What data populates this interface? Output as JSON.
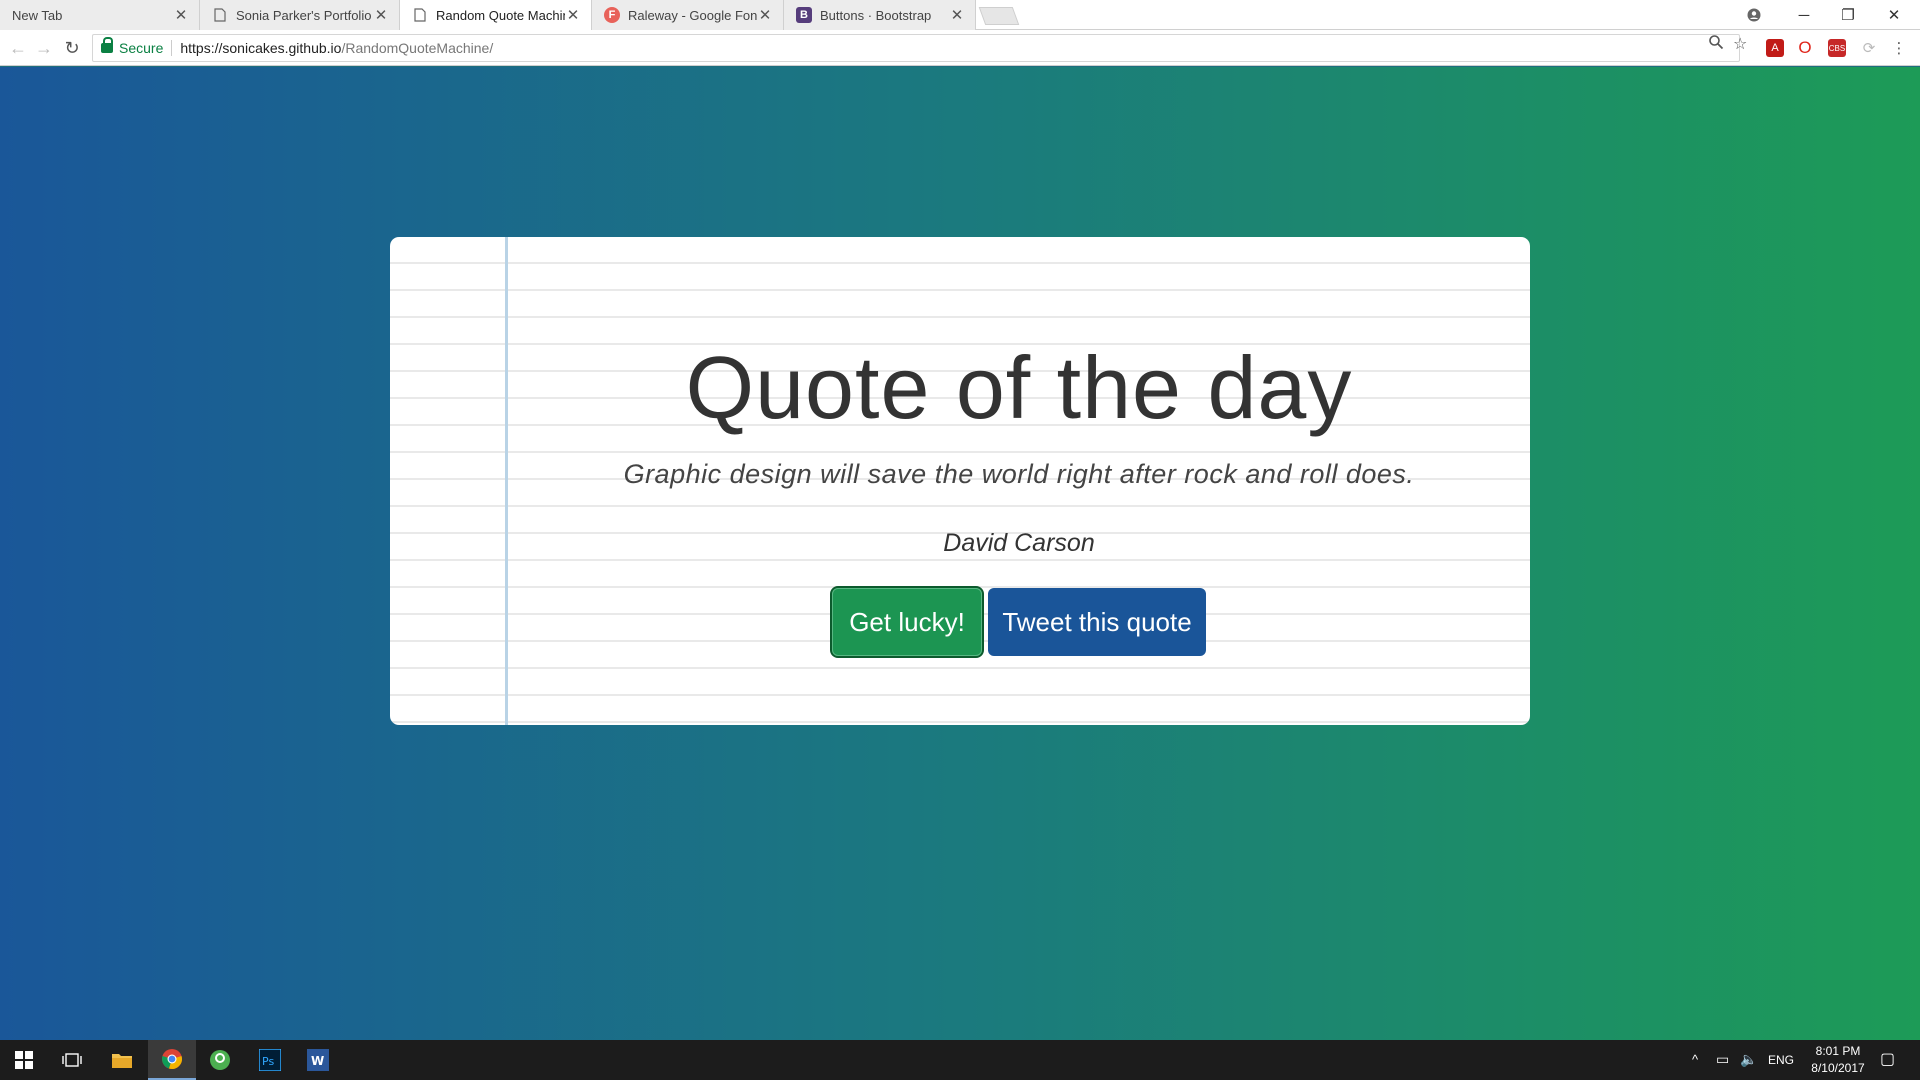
{
  "browser": {
    "tabs": [
      {
        "title": "New Tab",
        "icon": "none",
        "active": false
      },
      {
        "title": "Sonia Parker's Portfolio",
        "icon": "page-icon",
        "active": false
      },
      {
        "title": "Random Quote Machine",
        "icon": "page-icon",
        "active": true
      },
      {
        "title": "Raleway - Google Fonts",
        "icon": "google-fonts-icon",
        "active": false
      },
      {
        "title": "Buttons · Bootstrap",
        "icon": "bootstrap-icon",
        "active": false
      }
    ],
    "secure_label": "Secure",
    "url_host": "https://sonicakes.github.io",
    "url_path": "/RandomQuoteMachine/"
  },
  "page": {
    "title": "Quote of the day",
    "quote": "Graphic design will save the world right after rock and roll does.",
    "author": "David Carson",
    "buttons": {
      "lucky": "Get lucky!",
      "tweet": "Tweet this quote"
    }
  },
  "colors": {
    "gradient_start": "#1a5799",
    "gradient_end": "#1d9b57",
    "lucky_button": "#1c9552",
    "tweet_button": "#1a5599"
  },
  "taskbar": {
    "apps": [
      "windows-start-icon",
      "task-view-icon",
      "file-explorer-icon",
      "chrome-icon",
      "sourcetree-icon",
      "photoshop-icon",
      "word-icon"
    ],
    "language": "ENG",
    "time": "8:01 PM",
    "date": "8/10/2017"
  }
}
